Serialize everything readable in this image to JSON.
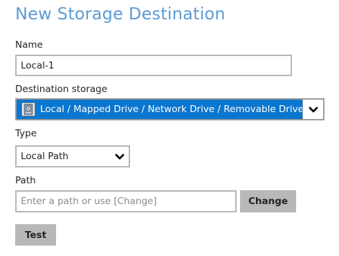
{
  "dialog": {
    "title": "New Storage Destination"
  },
  "name_field": {
    "label": "Name",
    "value": "Local-1"
  },
  "destination_storage": {
    "label": "Destination storage",
    "selected": "Local / Mapped Drive / Network Drive / Removable Drive",
    "icon": "drive-icon",
    "highlight_color": "#0a76d0"
  },
  "type_field": {
    "label": "Type",
    "selected": "Local Path"
  },
  "path_field": {
    "label": "Path",
    "value": "",
    "placeholder": "Enter a path or use [Change]"
  },
  "buttons": {
    "change_label": "Change",
    "test_label": "Test"
  },
  "colors": {
    "title": "#5b9bd5",
    "button": "#b8b8b8"
  }
}
